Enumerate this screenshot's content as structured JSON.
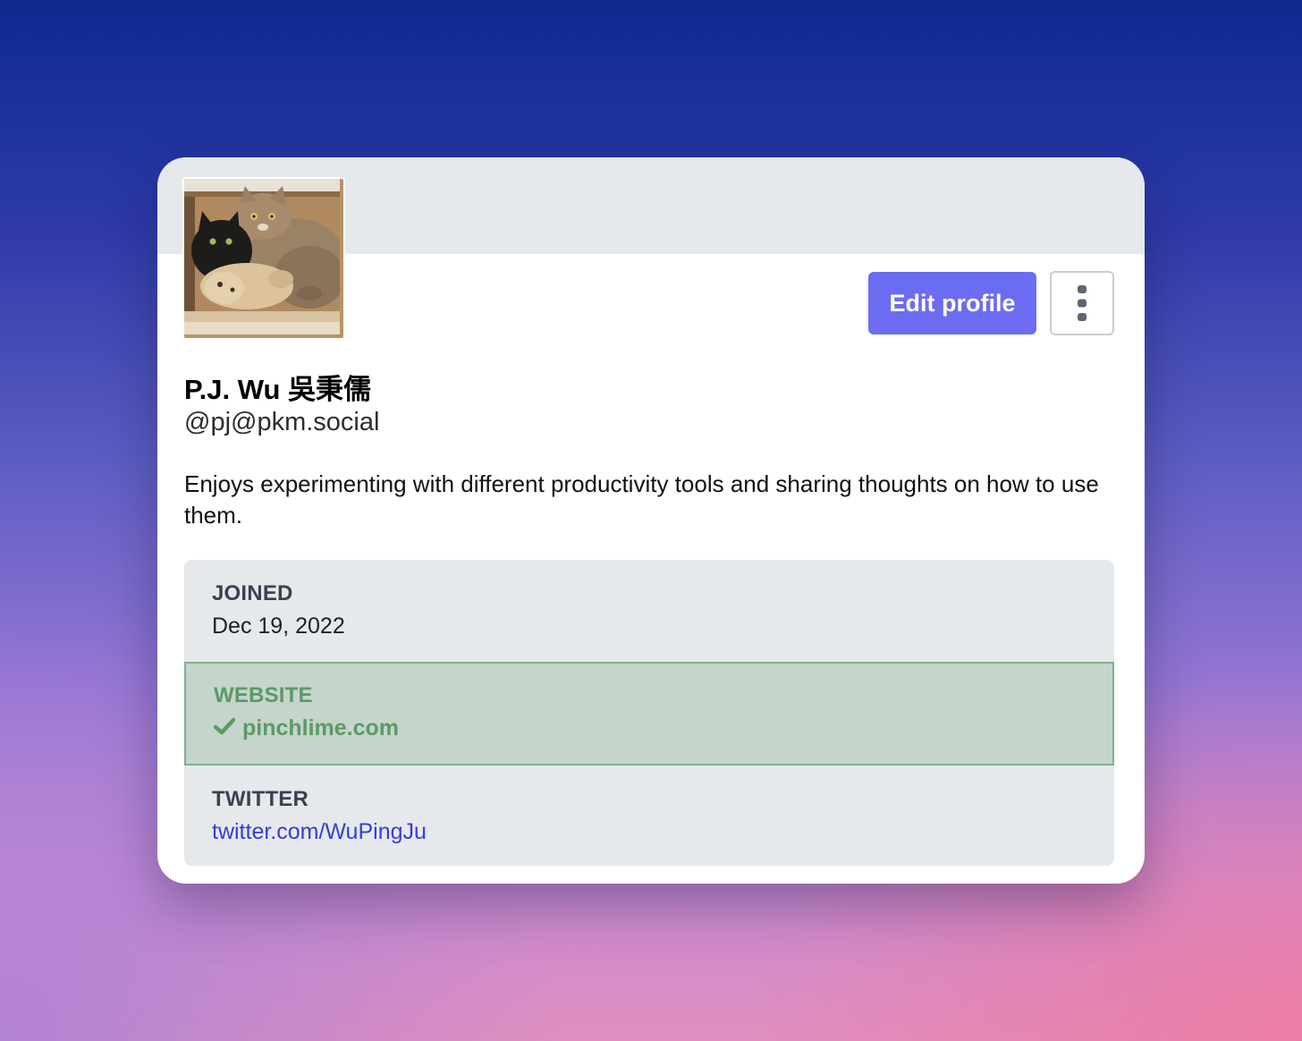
{
  "profile": {
    "display_name": "P.J. Wu 吳秉儒",
    "handle": "@pj@pkm.social",
    "bio": "Enjoys experimenting with different productivity tools and sharing thoughts on how to use them.",
    "avatar_icon": "avatar-photo-cats-in-box"
  },
  "actions": {
    "edit_label": "Edit profile",
    "more_icon": "vertical-ellipsis-icon"
  },
  "fields": {
    "joined": {
      "label": "JOINED",
      "value": "Dec 19, 2022"
    },
    "website": {
      "label": "WEBSITE",
      "value": "pinchlime.com",
      "verified": true,
      "icon": "check-icon"
    },
    "twitter": {
      "label": "TWITTER",
      "value": "twitter.com/WuPingJu"
    }
  },
  "colors": {
    "accent": "#6c6cf2",
    "verified_green": "#5a9a66",
    "link_blue": "#3a3adb",
    "field_background": "#e5e9ec"
  }
}
